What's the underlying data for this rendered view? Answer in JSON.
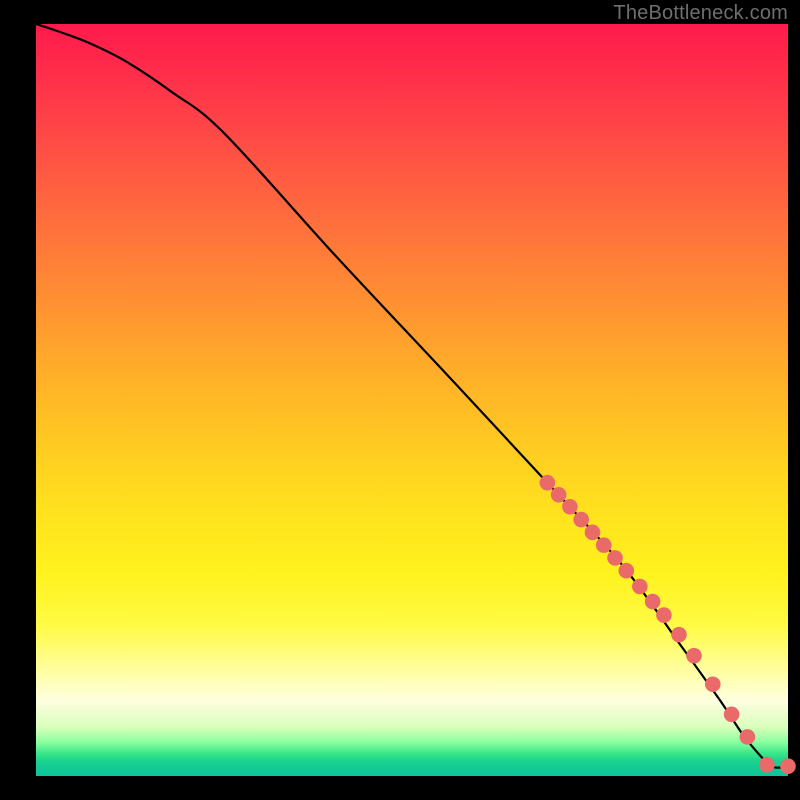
{
  "attribution_text": "TheBottleneck.com",
  "chart_data": {
    "type": "line",
    "title": "",
    "xlabel": "",
    "ylabel": "",
    "xlim": [
      0,
      100
    ],
    "ylim": [
      0,
      100
    ],
    "grid": false,
    "series": [
      {
        "name": "curve",
        "x": [
          0,
          3,
          7,
          12,
          18,
          25,
          40,
          55,
          68,
          78,
          86,
          91,
          94,
          96.5,
          98,
          100
        ],
        "y": [
          100,
          99,
          97.5,
          95,
          91,
          85.5,
          69,
          53,
          39,
          28,
          17,
          10,
          5.5,
          2.5,
          1.2,
          1.2
        ]
      }
    ],
    "scatter_points": {
      "name": "markers",
      "color": "#ea6a69",
      "x": [
        68,
        69.5,
        71,
        72.5,
        74,
        75.5,
        77,
        78.5,
        80.3,
        82,
        83.5,
        85.5,
        87.5,
        90,
        92.5,
        94.6,
        97.2,
        100
      ],
      "y": [
        39,
        37.4,
        35.8,
        34.1,
        32.4,
        30.7,
        29,
        27.3,
        25.2,
        23.2,
        21.4,
        18.8,
        16,
        12.2,
        8.2,
        5.2,
        1.5,
        1.3
      ]
    },
    "background_gradient": {
      "stops": [
        {
          "pos": 0.0,
          "color": "#ff1a4d"
        },
        {
          "pos": 0.35,
          "color": "#ff8a34"
        },
        {
          "pos": 0.65,
          "color": "#ffe21e"
        },
        {
          "pos": 0.9,
          "color": "#fefee0"
        },
        {
          "pos": 1.0,
          "color": "#0ec49a"
        }
      ]
    }
  }
}
